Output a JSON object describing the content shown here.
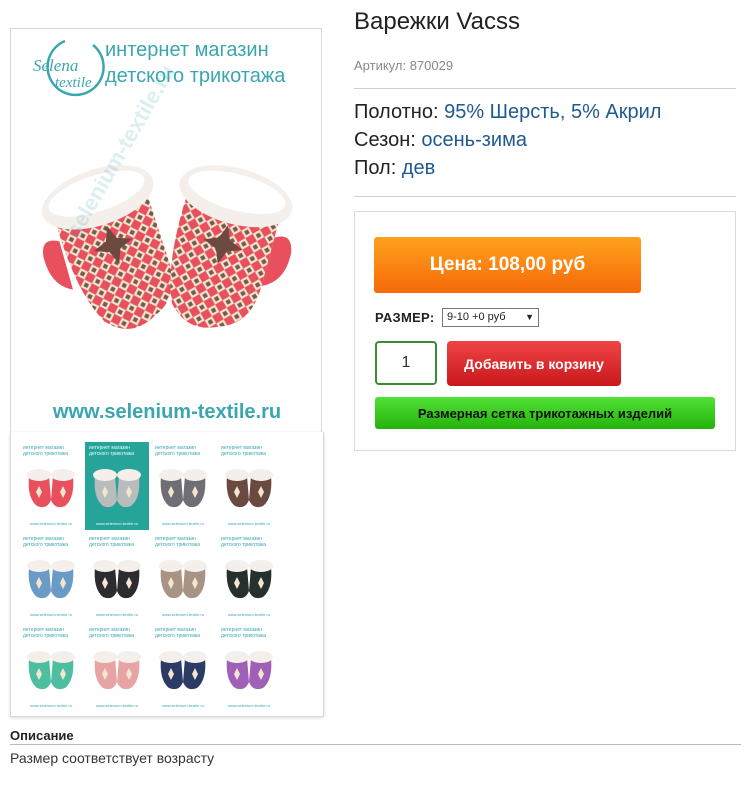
{
  "product": {
    "title": "Варежки Vacss",
    "sku_label": "Артикул:",
    "sku_value": "870029"
  },
  "attributes": [
    {
      "label": "Полотно:",
      "value": "95% Шерсть, 5% Акрил"
    },
    {
      "label": "Сезон:",
      "value": "осень-зима"
    },
    {
      "label": "Пол:",
      "value": "дев"
    }
  ],
  "image": {
    "brand_line1": "Selena",
    "brand_line2": "textile",
    "shop_line1": "интернет магазин",
    "shop_line2": "детского трикотажа",
    "url": "www.selenium-textile.ru",
    "watermark": "selenium-textile.ru",
    "thumb_header": "интернет магазин детского трикотажа",
    "thumb_url": "www.selenium-textile.ru"
  },
  "thumbnails": [
    {
      "name": "thumb-red",
      "color": "#e8505e",
      "selected": false
    },
    {
      "name": "thumb-grey",
      "color": "#b9bcbc",
      "selected": true
    },
    {
      "name": "thumb-dark-grey",
      "color": "#6e6e74",
      "selected": false
    },
    {
      "name": "thumb-brown",
      "color": "#6a4a40",
      "selected": false
    },
    {
      "name": "thumb-blue",
      "color": "#6a9ac6",
      "selected": false
    },
    {
      "name": "thumb-black",
      "color": "#2c2c30",
      "selected": false
    },
    {
      "name": "thumb-beige",
      "color": "#a89484",
      "selected": false
    },
    {
      "name": "thumb-black-green",
      "color": "#26302c",
      "selected": false
    },
    {
      "name": "thumb-mint",
      "color": "#4dbfa0",
      "selected": false
    },
    {
      "name": "thumb-pink",
      "color": "#e8a4a4",
      "selected": false
    },
    {
      "name": "thumb-navy",
      "color": "#2c3a66",
      "selected": false
    },
    {
      "name": "thumb-purple",
      "color": "#a060b8",
      "selected": false
    }
  ],
  "buy": {
    "price_button": "Цена: 108,00 руб",
    "size_label": "РАЗМЕР:",
    "size_selected": "9-10 +0 руб",
    "quantity": "1",
    "add_to_cart": "Добавить в корзину",
    "size_chart": "Размерная сетка трикотажных изделий"
  },
  "description": {
    "heading": "Описание",
    "text": "Размер соответствует возрасту"
  },
  "colors": {
    "accent_orange": "#f7841a",
    "cart_red": "#dd2a2e",
    "chart_green": "#3ccc20",
    "link_blue": "#1f5a8f",
    "brand_teal": "#3aa7b0"
  }
}
